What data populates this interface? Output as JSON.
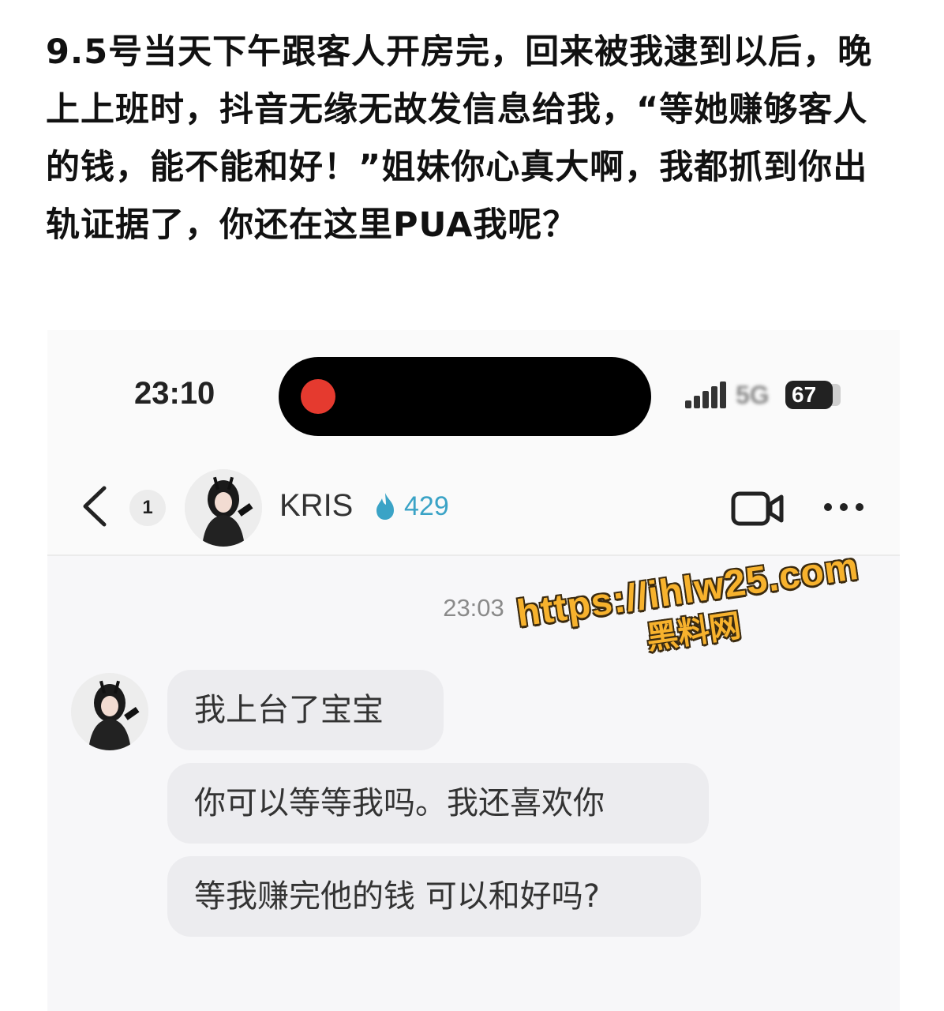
{
  "caption": {
    "text": "9.5号当天下午跟客人开房完，回来被我逮到以后，晚上上班时，抖音无缘无故发信息给我，“等她赚够客人的钱，能不能和好！”姐妹你心真大啊，我都抓到你出轨证据了，你还在这里PUA我呢？"
  },
  "status_bar": {
    "time": "23:10",
    "network": "5G",
    "battery": "67",
    "recording_color": "#e53a2f"
  },
  "chat_header": {
    "unread_count": "1",
    "contact_name": "KRIS",
    "fire_count": "429",
    "fire_color": "#3aa3c6"
  },
  "conversation": {
    "timestamp": "23:03",
    "messages": [
      {
        "sender": "KRIS",
        "text": "我上台了宝宝"
      },
      {
        "sender": "KRIS",
        "text": "你可以等等我吗。我还喜欢你"
      },
      {
        "sender": "KRIS",
        "text": "等我赚完他的钱 可以和好吗?"
      }
    ],
    "bubble_color": "#ececef"
  },
  "watermark": {
    "url": "https://ihlw25.com",
    "name": "黑料网",
    "color": "#f7b22d"
  }
}
